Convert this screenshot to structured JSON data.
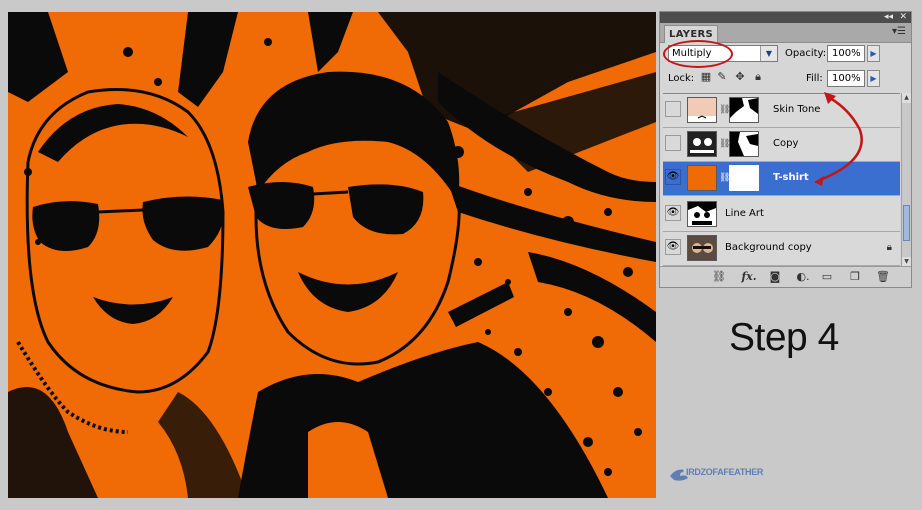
{
  "panel": {
    "tab_label": "LAYERS",
    "blend_mode": "Multiply",
    "opacity_label": "Opacity:",
    "opacity_value": "100%",
    "lock_label": "Lock:",
    "fill_label": "Fill:",
    "fill_value": "100%",
    "layers": [
      {
        "name": "Skin Tone",
        "visible": false,
        "selected": false,
        "thumb_color": "#f2cbb6"
      },
      {
        "name": "Copy",
        "visible": false,
        "selected": false,
        "thumb_color": "#1a1a1a"
      },
      {
        "name": "T-shirt",
        "visible": true,
        "selected": true,
        "thumb_color": "#f06a06"
      },
      {
        "name": "Line Art",
        "visible": true,
        "selected": false,
        "thumb_color": "#ffffff"
      },
      {
        "name": "Background copy",
        "visible": true,
        "selected": false,
        "thumb_color": "#6a6a6a"
      }
    ],
    "bottom_icons": [
      "link-icon",
      "fx-icon",
      "mask-icon",
      "adjustment-icon",
      "group-icon",
      "new-layer-icon",
      "trash-icon"
    ]
  },
  "annotation": {
    "step_text": "Step 4",
    "highlight_color": "#c41616"
  },
  "watermark": {
    "text": "IRDZOFAFEATHER"
  },
  "colors": {
    "photo_orange": "#f06a06",
    "selection_blue": "#3a6fd0"
  }
}
